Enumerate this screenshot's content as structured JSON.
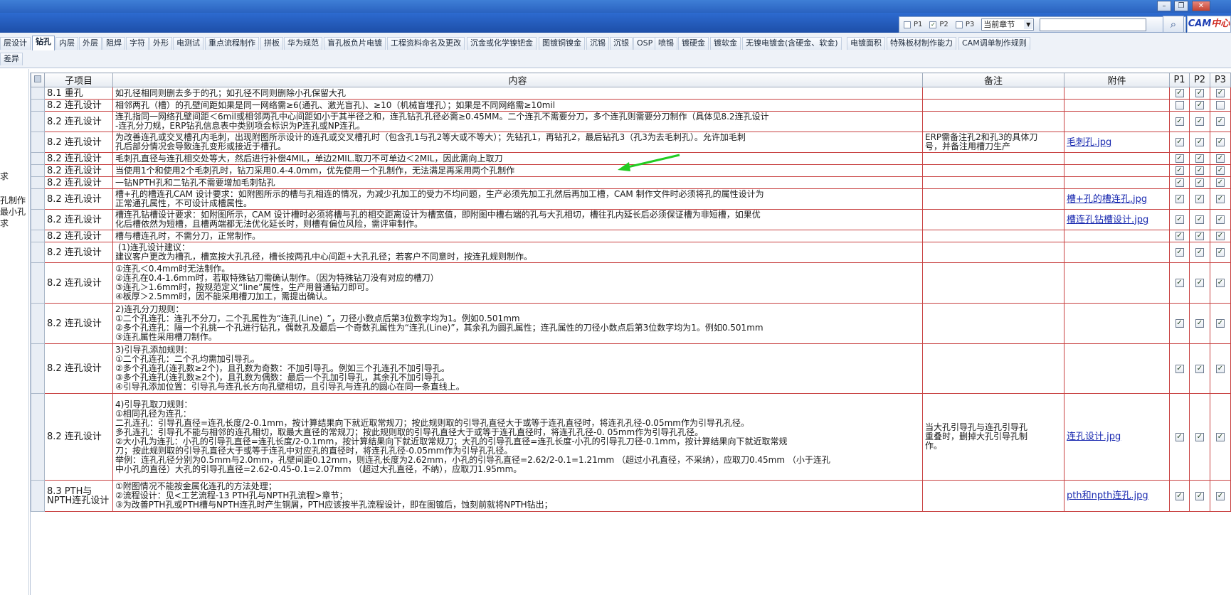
{
  "window": {
    "min_label": "–",
    "max_label": "❐",
    "close_label": "✕"
  },
  "filter": {
    "p1": {
      "label": "P1",
      "checked": false
    },
    "p2": {
      "label": "P2",
      "checked": true
    },
    "p3": {
      "label": "P3",
      "checked": false
    },
    "scope": "当前章节",
    "search_value": "",
    "search_icon": "magnifier-icon"
  },
  "logo": {
    "cam": "CAM",
    "zx": "中心"
  },
  "tabs": [
    "层设计",
    "钻孔",
    "内层",
    "外层",
    "阻焊",
    "字符",
    "外形",
    "电测试",
    "重点流程制作",
    "拼板",
    "华为规范",
    "盲孔板负片电镀",
    "工程资料命名及更改",
    "沉金或化学镍钯金",
    "图镀铜镍金",
    "沉锡",
    "沉银",
    "OSP",
    "喷锡",
    "镀硬金",
    "镀软金",
    "无镍电镀金(含硬金、软金)",
    "电镀面积",
    "特殊板材制作能力",
    "CAM调单制作规则"
  ],
  "tabs_row2": [
    "差异"
  ],
  "left_panel": {
    "line1": "求",
    "line2": "孔制作",
    "line3": "最小孔",
    "line4": "求"
  },
  "table": {
    "headers": {
      "sub": "子项目",
      "content": "内容",
      "remark": "备注",
      "attachment": "附件",
      "p1": "P1",
      "p2": "P2",
      "p3": "P3"
    },
    "rows": [
      {
        "sub": "8.1 重孔",
        "content": "如孔径相同则删去多于的孔；如孔径不同则删除小孔保留大孔",
        "remark": "",
        "att": "",
        "p1": true,
        "p2": true,
        "p3": true
      },
      {
        "sub": "8.2 连孔设计",
        "content": "相邻两孔（槽）的孔壁间距如果是同一网络需≥6(通孔、激光盲孔)、≥10（机械盲埋孔）；如果是不同网络需≥10mil",
        "remark": "",
        "att": "",
        "p1": false,
        "p2": true,
        "p3": false
      },
      {
        "sub": "8.2 连孔设计",
        "content": "连孔指同一网络孔壁间距＜6mil或相邻两孔中心间距如小于其半径之和，连孔钻孔孔径必需≥0.45MM。二个连孔不需要分刀，多个连孔则需要分刀制作（具体见8.2连孔设计\n-连孔分刀规，ERP钻孔信息表中类别项会标识为P连孔或NP连孔。",
        "remark": "",
        "att": "",
        "p1": true,
        "p2": true,
        "p3": true
      },
      {
        "sub": "8.2 连孔设计",
        "content": "为改善连孔或交叉槽孔内毛刺，出现附图所示设计的连孔或交叉槽孔时（包含孔1与孔2等大或不等大）；先钻孔1，再钻孔2，最后钻孔3（孔3为去毛刺孔）。允许加毛刺\n孔后部分情况会导致连孔变形或接近于槽孔。",
        "remark": "ERP需备注孔2和孔3的具体刀\n号，并备注用槽刀生产",
        "att": "毛刺孔.jpg",
        "p1": true,
        "p2": true,
        "p3": true
      },
      {
        "sub": "8.2 连孔设计",
        "content": "毛刺孔直径与连孔相交处等大，然后进行补偿4MIL，单边2MIL.取刀不可单边＜2MIL，因此需向上取刀",
        "remark": "",
        "att": "",
        "p1": true,
        "p2": true,
        "p3": true
      },
      {
        "sub": "8.2 连孔设计",
        "content": "当使用1个和使用2个毛刺孔时，钻刀采用0.4-4.0mm，优先使用一个孔制作，无法满足再采用两个孔制作",
        "remark": "",
        "att": "",
        "p1": true,
        "p2": true,
        "p3": true
      },
      {
        "sub": "8.2 连孔设计",
        "content": "一钻NPTH孔和二钻孔不需要增加毛刺钻孔",
        "remark": "",
        "att": "",
        "p1": true,
        "p2": true,
        "p3": true
      },
      {
        "sub": "8.2 连孔设计",
        "content": "槽+孔的槽连孔CAM 设计要求：如附图所示的槽与孔相连的情况，为减少孔加工的受力不均问题，生产必须先加工孔然后再加工槽，CAM 制作文件时必须将孔的属性设计为\n正常通孔属性，不可设计成槽属性。",
        "remark": "",
        "att": "槽+孔的槽连孔.jpg",
        "p1": true,
        "p2": true,
        "p3": true
      },
      {
        "sub": "8.2 连孔设计",
        "content": "槽连孔钻槽设计要求：如附图所示，CAM 设计槽时必须将槽与孔的相交距离设计为槽宽值，即附图中槽右端的孔与大孔相切，槽往孔内延长后必须保证槽为非短槽，如果优\n化后槽依然为短槽，且槽两端都无法优化延长时，则槽有偏位风险，需评审制作。",
        "remark": "",
        "att": "槽连孔钻槽设计.jpg",
        "p1": true,
        "p2": true,
        "p3": true
      },
      {
        "sub": "8.2 连孔设计",
        "content": "槽与槽连孔时，不需分刀，正常制作。",
        "remark": "",
        "att": "",
        "p1": true,
        "p2": true,
        "p3": true
      },
      {
        "sub": "8.2 连孔设计",
        "content": " (1)连孔设计建议：\n建议客户更改为槽孔，槽宽按大孔孔径，槽长按两孔中心间距+大孔孔径；若客户不同意时，按连孔规则制作。",
        "remark": "",
        "att": "",
        "p1": true,
        "p2": true,
        "p3": true
      },
      {
        "sub": "8.2 连孔设计",
        "content": "①连孔＜0.4mm时无法制作。\n②连孔在0.4-1.6mm时，若取特殊钻刀需确认制作。（因为特殊钻刀没有对应的槽刀）\n③连孔＞1.6mm时，按规范定义“line”属性，生产用普通钻刀即可。\n④板厚＞2.5mm时，因不能采用槽刀加工，需提出确认。",
        "remark": "",
        "att": "",
        "p1": true,
        "p2": true,
        "p3": true
      },
      {
        "sub": "8.2 连孔设计",
        "content": "2)连孔分刀规则：\n①二个孔连孔：连孔不分刀，二个孔属性为“连孔(Line)_”，刀径小数点后第3位数字均为1。例如0.501mm\n②多个孔连孔：隔一个孔挑一个孔进行钻孔，偶数孔及最后一个奇数孔属性为“连孔(Line)”，其余孔为圆孔属性；连孔属性的刀径小数点后第3位数字均为1。例如0.501mm\n③连孔属性采用槽刀制作。",
        "remark": "",
        "att": "",
        "p1": true,
        "p2": true,
        "p3": true
      },
      {
        "sub": "8.2 连孔设计",
        "content": "3)引导孔添加规则：\n①二个孔连孔：二个孔均需加引导孔。\n②多个孔连孔(连孔数≥2个)，且孔数为奇数：不加引导孔。例如三个孔连孔不加引导孔。\n③多个孔连孔(连孔数≥2个)，且孔数为偶数：最后一个孔加引导孔，其余孔不加引导孔。\n④引导孔添加位置：引导孔与连孔长方向孔壁相切，且引导孔与连孔的圆心在同一条直线上。",
        "remark": "",
        "att": "",
        "p1": true,
        "p2": true,
        "p3": true
      },
      {
        "sub": "8.2 连孔设计",
        "content": "4)引导孔取刀规则：\n①相同孔径为连孔：\n二孔连孔：引导孔直径=连孔长度/2-0.1mm，按计算结果向下就近取常规刀；按此规则取的引导孔直径大于或等于连孔直径时，将连孔孔径-0.05mm作为引导孔孔径。\n多孔连孔：引导孔不能与相邻的连孔相切，取最大直径的常规刀；按此规则取的引导孔直径大于或等于连孔直径时，将连孔孔径-0. 05mm作为引导孔孔径。\n②大小孔为连孔：小孔的引导孔直径=连孔长度/2-0.1mm，按计算结果向下就近取常规刀；大孔的引导孔直径=连孔长度-小孔的引导孔刀径-0.1mm，按计算结果向下就近取常规\n刀；按此规则取的引导孔直径大于或等于连孔中对应孔的直径时，将连孔孔径-0.05mm作为引导孔孔径。\n举例：连孔孔径分别为0.5mm与2.0mm，孔壁间距0.12mm，则连孔长度为2.62mm，小孔的引导孔直径=2.62/2-0.1=1.21mm （超过小孔直径，不采纳），应取刀0.45mm （小于连孔\n中小孔的直径）大孔的引导孔直径=2.62-0.45-0.1=2.07mm （超过大孔直径，不纳），应取刀1.95mm。",
        "remark": "当大孔引导孔与连孔引导孔\n重叠时，删掉大孔引导孔制\n作。",
        "att": "连孔设计.jpg",
        "p1": true,
        "p2": true,
        "p3": true
      },
      {
        "sub": "8.3 PTH与\nNPTH连孔设计",
        "content": "①附图情况不能按金属化连孔的方法处理；\n②流程设计：见<工艺流程-13 PTH孔与NPTH孔流程>章节；\n③为改善PTH孔或PTH槽与NPTH连孔时产生铜屑，PTH应该按半孔流程设计，即在图镀后，蚀刻前就将NPTH钻出；",
        "remark": "",
        "att": "pth和npth连孔.jpg",
        "p1": true,
        "p2": true,
        "p3": true
      }
    ]
  }
}
